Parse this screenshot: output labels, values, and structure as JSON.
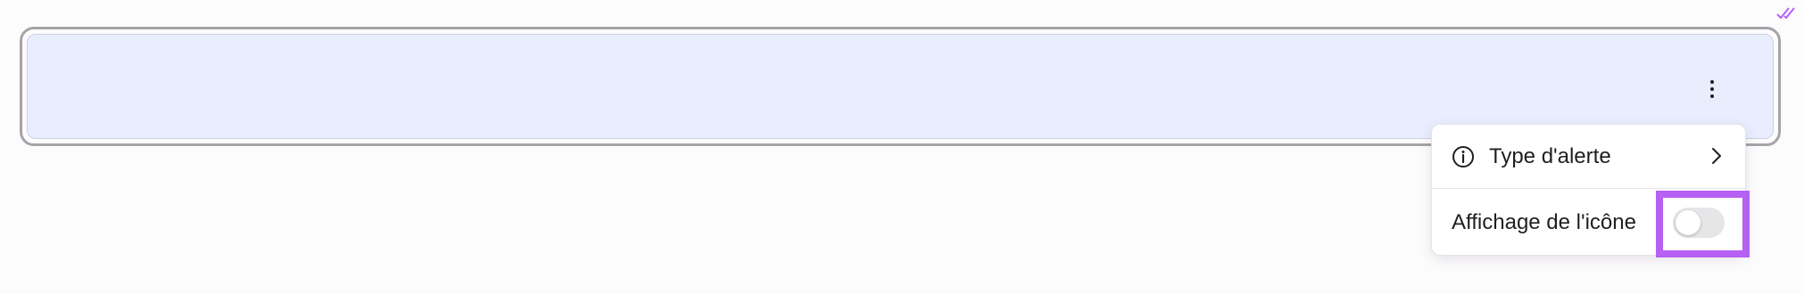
{
  "menu": {
    "type_item": {
      "label": "Type d'alerte",
      "icon": "info-icon",
      "trailing_icon": "chevron-right-icon"
    },
    "display_item": {
      "label": "Affichage de l'icône",
      "toggle_state": "off"
    }
  },
  "colors": {
    "alert_background": "#e9eefe",
    "alert_border": "#a7a3a9",
    "highlight": "#b660f4",
    "toggle_track_off": "#e6e5e8"
  }
}
